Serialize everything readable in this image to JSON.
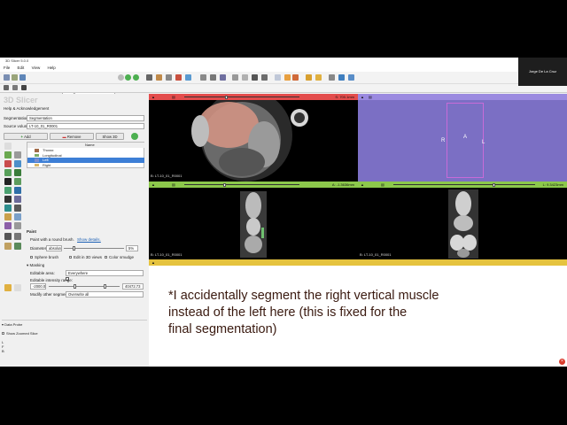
{
  "window": {
    "title": "3D Slicer 5.0.0"
  },
  "menu": [
    "File",
    "Edit",
    "View",
    "Help"
  ],
  "toolbar": {
    "modules_label": "Modules:",
    "module_selected": "Segment Editor"
  },
  "user": {
    "name": "Jorge De La Cruz"
  },
  "logo": "3D Slicer",
  "panel": {
    "help_label": "Help & Acknowledgement",
    "segmentation_label": "Segmentation:",
    "segmentation_value": "Segmentation",
    "source_label": "Source volume:",
    "source_value": "LT-10_01_R0001",
    "add_label": "Add",
    "remove_label": "Remove",
    "show3d_label": "Show 3D",
    "table_header": "Name",
    "segments": [
      {
        "name": "Thorax",
        "color": "#a06a48"
      },
      {
        "name": "Longitudinal",
        "color": "#7fae6a"
      },
      {
        "name": "Left",
        "color": "#7a8ed0"
      },
      {
        "name": "Right",
        "color": "#d9b86c"
      }
    ],
    "paint_label": "Paint",
    "paint_desc": "Paint with a round brush.",
    "paint_details": "Show details.",
    "diameter_label": "Diameter:",
    "diameter_mode": "absolute",
    "diameter_value": "5%",
    "sphere_brush": "Sphere brush",
    "edit_3d": "Edit in 3D views",
    "color_smudge": "Color smudge",
    "masking_label": "Masking",
    "editable_area_label": "Editable area:",
    "editable_area_value": "Everywhere",
    "intensity_label": "Editable intensity range:",
    "intensity_min": "-2000.00",
    "intensity_max": "40472.73",
    "modify_label": "Modify other segments:",
    "modify_value": "Overwrite all",
    "probe_label": "Data Probe",
    "zoomed_slice": "Show Zoomed Slice",
    "probe_L": "L",
    "probe_F": "F",
    "probe_B": "B"
  },
  "views": {
    "red": {
      "label": "B: LT-10_01_R0001",
      "offset": "S: 700.1mm",
      "color": "#e34c4c"
    },
    "purple": {
      "color": "#9b8ae0",
      "marker_R": "R",
      "marker_A": "A",
      "marker_L": "L"
    },
    "green_left": {
      "label": "B: LT-10_01_R0001",
      "offset": "A: -1.3636mm",
      "color": "#8cc84b"
    },
    "green_right": {
      "label": "B: LT-10_01_R0001",
      "offset": "L: 9.3423mm",
      "color": "#8cc84b"
    },
    "yellow": {
      "color": "#e5c33f"
    }
  },
  "caption": {
    "line1": "*I accidentally segment the right vertical muscle",
    "line2": "instead of the left here (this is fixed for the",
    "line3": "final segmentation)"
  }
}
